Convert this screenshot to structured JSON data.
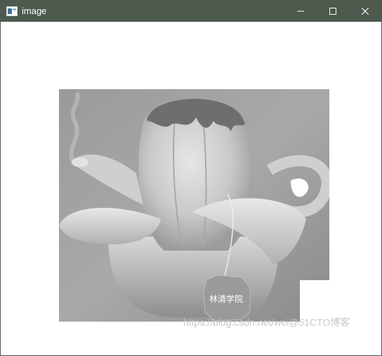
{
  "window": {
    "title": "image",
    "icon": "opencv-window-icon",
    "controls": {
      "minimize_icon": "minimize-icon",
      "maximize_icon": "maximize-icon",
      "close_icon": "close-icon"
    }
  },
  "image": {
    "subject": "grayscale teapot shaped like a peeled banana with a tea bag",
    "tea_bag_label": "林清学院"
  },
  "watermark": {
    "text": "https://blog.csdn.net/wei@51CTO博客"
  },
  "colors": {
    "titlebar": "#4d5a4d",
    "background": "#ffffff"
  }
}
